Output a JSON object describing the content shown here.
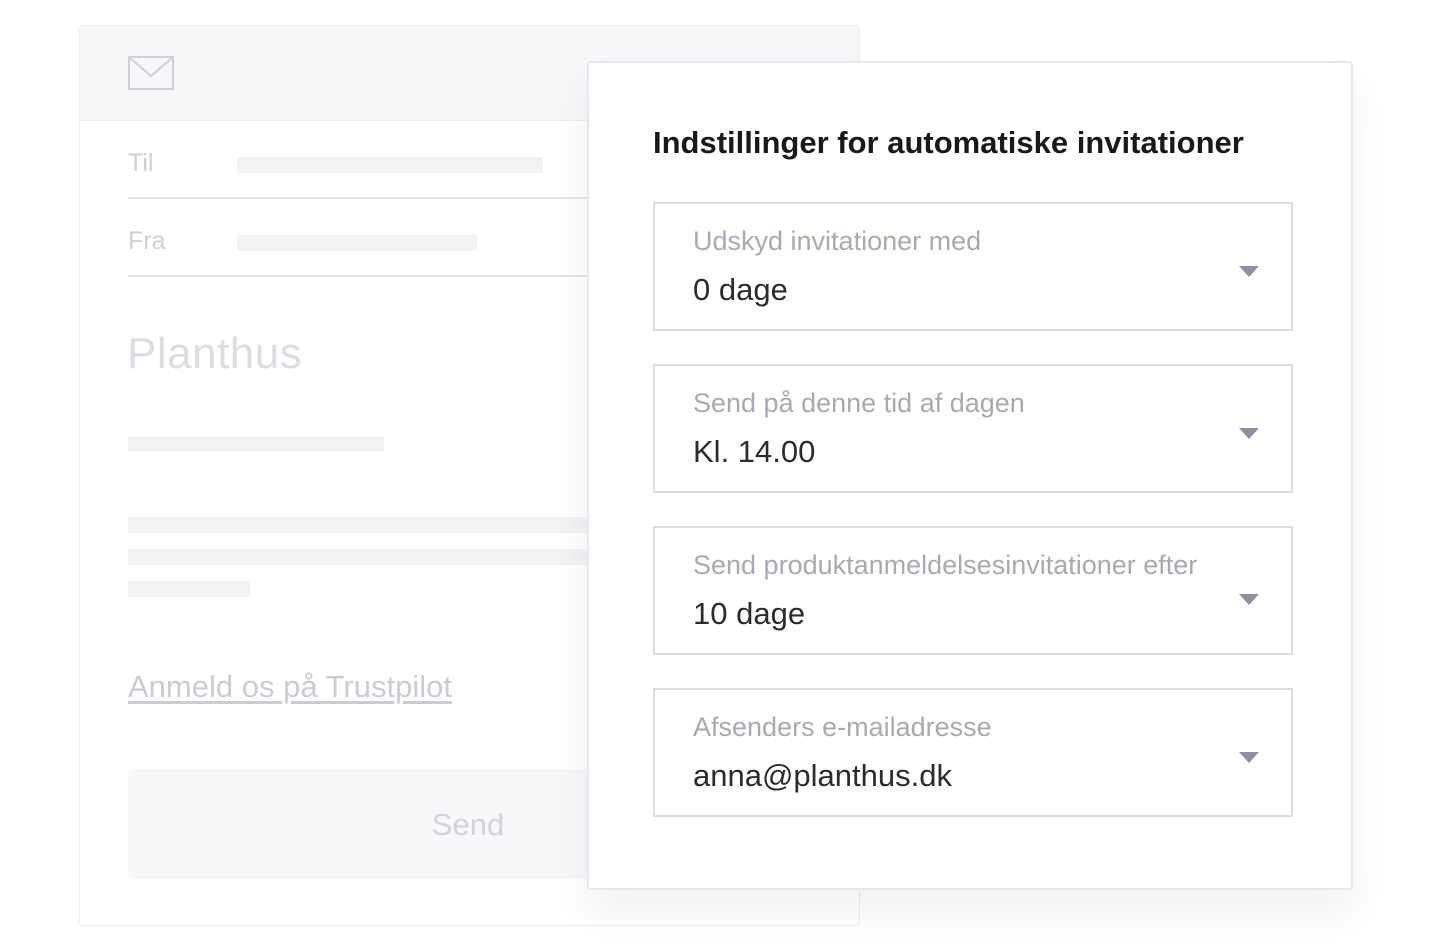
{
  "email": {
    "to_label": "Til",
    "from_label": "Fra",
    "brand": "Planthus",
    "review_link": "Anmeld os på Trustpilot",
    "send_label": "Send"
  },
  "settings": {
    "title": "Indstillinger for automatiske invitationer",
    "fields": [
      {
        "label": "Udskyd invitationer med",
        "value": "0 dage"
      },
      {
        "label": "Send på denne tid af dagen",
        "value": "Kl. 14.00"
      },
      {
        "label": "Send produktanmeldelsesinvitationer efter",
        "value": "10 dage"
      },
      {
        "label": "Afsenders e-mailadresse",
        "value": "anna@planthus.dk"
      }
    ]
  },
  "colors": {
    "panel_border": "#e6e6ec",
    "label_gray": "#a8a8b8",
    "value_dark": "#2b2b33",
    "caret": "#8f8fa3"
  },
  "icons": {
    "envelope": "envelope-icon",
    "dropdown": "chevron-down-icon"
  }
}
